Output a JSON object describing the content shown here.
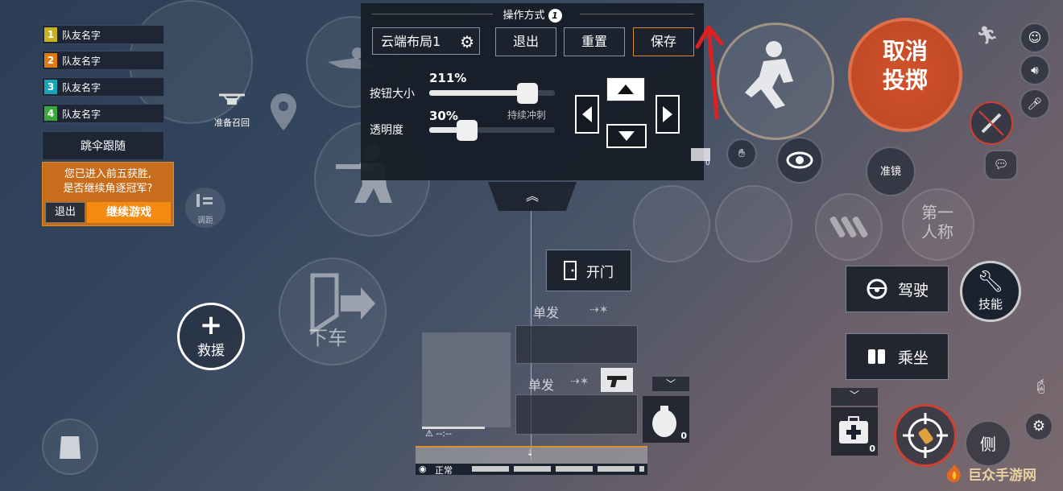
{
  "teammates": [
    {
      "num": "1",
      "name": "队友名字",
      "color": "#c8b020"
    },
    {
      "num": "2",
      "name": "队友名字",
      "color": "#e07a10"
    },
    {
      "num": "3",
      "name": "队友名字",
      "color": "#1aa4b8"
    },
    {
      "num": "4",
      "name": "队友名字",
      "color": "#3aa83a"
    }
  ],
  "follow_button": "跳伞跟随",
  "continue_prompt": {
    "message_line1": "您已进入前五获胜,",
    "message_line2": "是否继续角逐冠军?",
    "exit_label": "退出",
    "continue_label": "继续游戏"
  },
  "drone_label": "准备召回",
  "range_label": "调距",
  "panel": {
    "title": "操作方式",
    "title_badge": "1",
    "layout_name": "云端布局1",
    "exit_label": "退出",
    "reset_label": "重置",
    "save_label": "保存",
    "size_label": "按钮大小",
    "size_value": "211%",
    "size_fraction": 0.78,
    "opacity_label": "透明度",
    "opacity_value": "30%",
    "opacity_fraction": 0.3,
    "sprint_label": "持续冲刺"
  },
  "open_door_label": "开门",
  "single_fire_1": "单发",
  "single_fire_2": "单发",
  "ammo_status": "--:--",
  "status_label": "正常",
  "grenade_count": "0",
  "medkit_count": "0",
  "grenade_box_count": "0",
  "exit_vehicle_label": "下车",
  "rescue_label": "救援",
  "cancel_throw_line1": "取消",
  "cancel_throw_line2": "投掷",
  "scope_label": "准镜",
  "first_person_line1": "第一",
  "first_person_line2": "人称",
  "drive_label": "驾驶",
  "ride_label": "乘坐",
  "skill_label": "技能",
  "lean_label": "侧",
  "watermark_text": "巨众手游网",
  "accent_colors": {
    "cancel": "#d9542b",
    "save_border": "#e08a30",
    "annotation": "#e02020"
  }
}
